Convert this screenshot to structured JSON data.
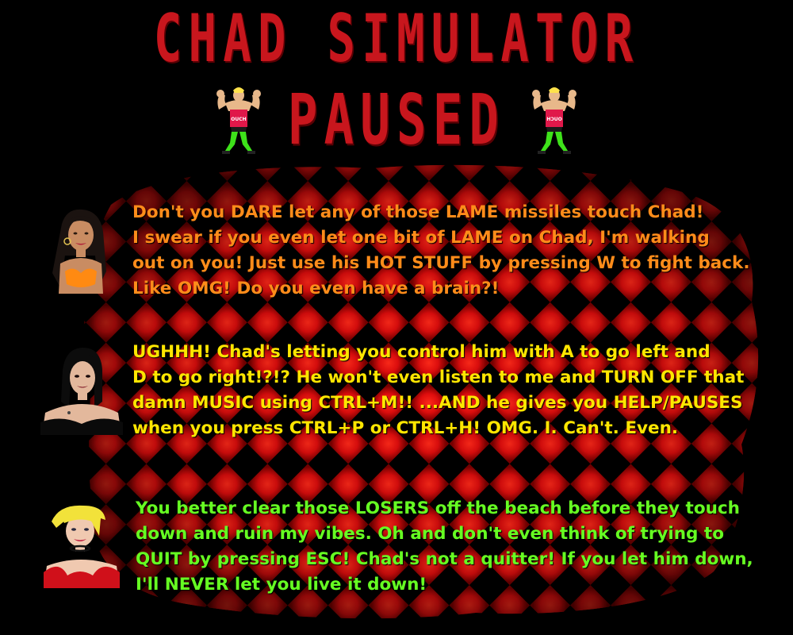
{
  "game_title": "CHAD SIMULATOR",
  "pause_label": "PAUSED",
  "colors": {
    "title": "#c8161d",
    "background": "#000000",
    "board_red": "#e01010",
    "message_1": "#ff8c1a",
    "message_2": "#ffe600",
    "message_3": "#66ff22"
  },
  "mascot_shirt_text": "OUCH",
  "messages": [
    {
      "speaker_icon": "brunette-girl-portrait",
      "text": "Don't you DARE let any of those LAME missiles touch Chad!\nI swear if you even let one bit of LAME on Chad, I'm walking\nout on you! Just use his HOT STUFF by pressing W to fight back.\nLike OMG! Do you even have a brain?!"
    },
    {
      "speaker_icon": "goth-girl-portrait",
      "text": "UGHHH! Chad's letting you control him with A to go left and\nD to go right!?!? He won't even listen to me and TURN OFF that\ndamn MUSIC using CTRL+M!! ...AND he gives you HELP/PAUSES\nwhen you press CTRL+P or CTRL+H! OMG. I. Can't. Even."
    },
    {
      "speaker_icon": "blonde-girl-portrait",
      "text": "You better clear those LOSERS off the beach before they touch\ndown and ruin my vibes. Oh and don't even think of trying to\nQUIT by pressing ESC! Chad's not a quitter! If you let him down,\nI'll NEVER let you live it down!"
    }
  ]
}
